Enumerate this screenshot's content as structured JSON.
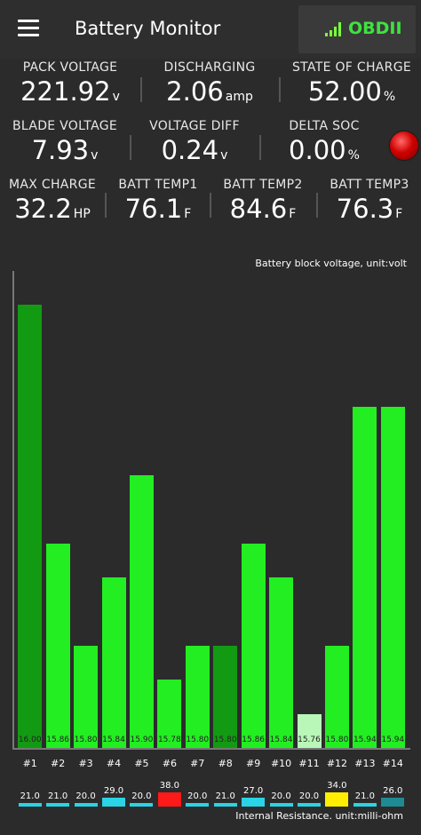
{
  "header": {
    "title": "Battery Monitor",
    "obd_label": "OBDII",
    "obd_color": "#3ee23e"
  },
  "stats": {
    "pack_voltage": {
      "label": "PACK VOLTAGE",
      "value": "221.92",
      "unit": "v"
    },
    "discharging": {
      "label": "DISCHARGING",
      "value": "2.06",
      "unit": "amp"
    },
    "state_of_charge": {
      "label": "STATE OF CHARGE",
      "value": "52.00",
      "unit": "%"
    },
    "blade_voltage": {
      "label": "BLADE VOLTAGE",
      "value": "7.93",
      "unit": "v"
    },
    "voltage_diff": {
      "label": "VOLTAGE DIFF",
      "value": "0.24",
      "unit": "v"
    },
    "delta_soc": {
      "label": "DELTA SOC",
      "value": "0.00",
      "unit": "%"
    },
    "max_charge": {
      "label": "MAX CHARGE",
      "value": "32.2",
      "unit": "HP"
    },
    "batt_temp1": {
      "label": "BATT TEMP1",
      "value": "76.1",
      "unit": "F"
    },
    "batt_temp2": {
      "label": "BATT TEMP2",
      "value": "84.6",
      "unit": "F"
    },
    "batt_temp3": {
      "label": "BATT TEMP3",
      "value": "76.3",
      "unit": "F"
    }
  },
  "status_light_color": "#d10000",
  "chart_data": {
    "type": "bar",
    "title": "Battery block voltage, unit:volt",
    "categories": [
      "#1",
      "#2",
      "#3",
      "#4",
      "#5",
      "#6",
      "#7",
      "#8",
      "#9",
      "#10",
      "#11",
      "#12",
      "#13",
      "#14"
    ],
    "values": [
      16.0,
      15.86,
      15.8,
      15.84,
      15.9,
      15.78,
      15.8,
      15.8,
      15.86,
      15.84,
      15.76,
      15.8,
      15.94,
      15.94
    ],
    "value_labels": [
      "16.00",
      "15.86",
      "15.80",
      "15.84",
      "15.90",
      "15.78",
      "15.80",
      "15.80",
      "15.86",
      "15.84",
      "15.76",
      "15.80",
      "15.94",
      "15.94"
    ],
    "bar_colors": [
      "#129b12",
      "#22ee22",
      "#22ee22",
      "#22ee22",
      "#22ee22",
      "#22ee22",
      "#22ee22",
      "#129b12",
      "#22ee22",
      "#22ee22",
      "#b8f7b8",
      "#22ee22",
      "#22ee22",
      "#22ee22"
    ],
    "ylim": [
      15.74,
      16.02
    ],
    "resistance_title": "Internal Resistance. unit:milli-ohm",
    "resistance_values": [
      21.0,
      21.0,
      20.0,
      29.0,
      20.0,
      38.0,
      20.0,
      21.0,
      27.0,
      20.0,
      20.0,
      34.0,
      21.0,
      26.0
    ],
    "resistance_labels": [
      "21.0",
      "21.0",
      "20.0",
      "29.0",
      "20.0",
      "38.0",
      "20.0",
      "21.0",
      "27.0",
      "20.0",
      "20.0",
      "34.0",
      "21.0",
      "26.0"
    ],
    "resistance_colors": [
      "#2ad3e6",
      "#2ad3e6",
      "#2ad3e6",
      "#2ad3e6",
      "#2ad3e6",
      "#ff1a1a",
      "#2ad3e6",
      "#2ad3e6",
      "#2ad3e6",
      "#2ad3e6",
      "#2ad3e6",
      "#ffee00",
      "#2ad3e6",
      "#1e8a93"
    ]
  }
}
